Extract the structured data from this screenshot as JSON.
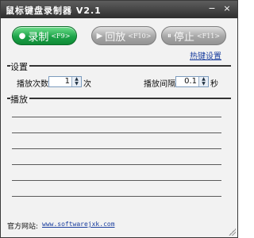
{
  "window": {
    "title": "鼠标键盘录制器 V2.1",
    "minimize_symbol": "−",
    "close_symbol": "×"
  },
  "controls": {
    "record": {
      "label": "录制",
      "hotkey": "<F9>",
      "symbol": "●",
      "enabled": true
    },
    "play": {
      "label": "回放",
      "hotkey": "<F10>",
      "symbol": "▶",
      "enabled": false
    },
    "stop": {
      "label": "停止",
      "hotkey": "<F11>",
      "symbol": "⏸",
      "enabled": false
    }
  },
  "hotkey_settings_link": "热键设置",
  "settings": {
    "section_title": "设置",
    "play_count_label": "播放次数",
    "play_count_value": "1",
    "play_count_unit": "次",
    "interval_label": "播放间隔",
    "interval_value": "0.1",
    "interval_unit": "秒"
  },
  "playback": {
    "section_title": "播放",
    "lines": [
      "",
      "",
      "",
      "",
      "",
      ""
    ]
  },
  "footer": {
    "label": "官方网站:",
    "url": "www.softwarejxk.com"
  },
  "colors": {
    "record_green": "#1ea44a",
    "disabled_gray": "#a7a7a7",
    "link_blue": "#1a3e9e",
    "titlebar": "#3a3a3a"
  }
}
